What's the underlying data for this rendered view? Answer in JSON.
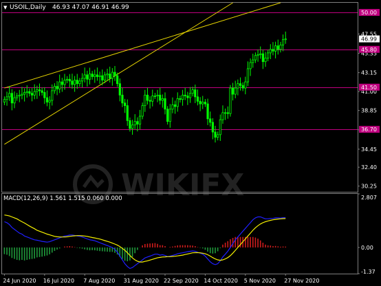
{
  "header": {
    "symbol_label": "USOIL,Daily",
    "ohlc_label": "46.93 47.07 46.91 46.99"
  },
  "macd_header": {
    "label": "MACD(12,26,9) 1.561 1.515 0.060 0.000"
  },
  "watermark": "WIKIFX",
  "colors": {
    "background": "#000000",
    "frame": "#7f7f7f",
    "candle": "#00ff00",
    "level_line": "#c0007f",
    "trend_line": "#e8d600",
    "macd_hist_positive": "#d01c1c",
    "macd_hist_negative": "#1f9a3b",
    "macd_line": "#2020ff",
    "signal_line": "#f5f000",
    "price_tag_bg": "#ffffff"
  },
  "chart_data": {
    "type": "candlestick",
    "title": "USOIL,Daily",
    "price_axis": {
      "ticks": [
        47.55,
        45.35,
        43.15,
        41.0,
        38.85,
        36.65,
        34.45,
        32.4,
        30.25
      ],
      "tick_labels": [
        "47.55",
        "45.35",
        "43.15",
        "41.00",
        "38.85",
        "36.65",
        "34.45",
        "32.40",
        "30.25"
      ],
      "range": [
        29.6,
        51.1
      ]
    },
    "date_axis": {
      "labels": [
        "24 Jun 2020",
        "16 Jul 2020",
        "7 Aug 2020",
        "31 Aug 2020",
        "22 Sep 2020",
        "14 Oct 2020",
        "5 Nov 2020",
        "27 Nov 2020"
      ]
    },
    "current_price": "46.99",
    "horizontal_levels": [
      {
        "value": 50.0,
        "label": "50.00"
      },
      {
        "value": 45.8,
        "label": "45.80"
      },
      {
        "value": 41.5,
        "label": "41.50"
      },
      {
        "value": 36.7,
        "label": "36.70"
      }
    ],
    "trend_lines": [
      {
        "from": {
          "bar": 0,
          "price": 41.4
        },
        "to": {
          "bar": 110,
          "price": 51.1
        }
      },
      {
        "from": {
          "bar": 0,
          "price": 35.0
        },
        "to": {
          "bar": 91,
          "price": 51.1
        }
      }
    ],
    "close": [
      40.1,
      40.4,
      40.8,
      39.7,
      40.3,
      40.5,
      40.6,
      40.7,
      40.9,
      41.0,
      40.8,
      40.6,
      41.0,
      41.2,
      41.1,
      40.9,
      40.3,
      39.8,
      40.0,
      41.1,
      41.6,
      41.3,
      42.1,
      41.8,
      42.3,
      42.4,
      42.2,
      41.8,
      42.3,
      41.9,
      42.2,
      42.5,
      42.9,
      42.4,
      43.0,
      42.7,
      42.9,
      42.7,
      42.8,
      42.3,
      42.9,
      43.0,
      42.5,
      43.2,
      42.8,
      41.9,
      40.6,
      39.7,
      39.4,
      37.7,
      36.8,
      37.2,
      37.6,
      37.3,
      38.2,
      39.4,
      40.6,
      40.0,
      39.9,
      40.5,
      40.5,
      40.6,
      40.0,
      40.2,
      39.0,
      37.6,
      39.0,
      39.5,
      39.3,
      40.2,
      40.1,
      40.6,
      40.5,
      40.3,
      40.8,
      41.2,
      40.4,
      39.9,
      39.6,
      39.8,
      39.6,
      37.9,
      37.5,
      36.4,
      35.8,
      36.1,
      37.8,
      38.6,
      38.6,
      38.5,
      41.4,
      40.7,
      41.4,
      41.9,
      41.7,
      41.4,
      42.1,
      43.6,
      44.3,
      44.6,
      45.1,
      45.2,
      45.3,
      44.4,
      44.8,
      45.4,
      45.8,
      45.6,
      46.2,
      45.8,
      46.3,
      46.9,
      46.99
    ],
    "macd": {
      "axis_ticks": [
        2.807,
        0.0,
        -1.37
      ],
      "axis_tick_labels": [
        "2.807",
        "0.00",
        "-1.37"
      ],
      "range": [
        -1.37,
        2.807
      ],
      "macd_line": [
        1.35,
        1.3,
        1.2,
        1.05,
        0.95,
        0.85,
        0.75,
        0.7,
        0.6,
        0.55,
        0.5,
        0.45,
        0.4,
        0.38,
        0.35,
        0.32,
        0.3,
        0.28,
        0.3,
        0.35,
        0.4,
        0.45,
        0.5,
        0.55,
        0.6,
        0.62,
        0.65,
        0.65,
        0.63,
        0.6,
        0.58,
        0.55,
        0.5,
        0.45,
        0.4,
        0.38,
        0.35,
        0.3,
        0.25,
        0.2,
        0.15,
        0.1,
        0.05,
        0.0,
        -0.1,
        -0.25,
        -0.45,
        -0.65,
        -0.85,
        -1.0,
        -1.1,
        -1.05,
        -0.95,
        -0.85,
        -0.75,
        -0.65,
        -0.55,
        -0.5,
        -0.45,
        -0.4,
        -0.35,
        -0.35,
        -0.4,
        -0.38,
        -0.42,
        -0.48,
        -0.45,
        -0.42,
        -0.38,
        -0.33,
        -0.3,
        -0.28,
        -0.25,
        -0.22,
        -0.2,
        -0.18,
        -0.2,
        -0.25,
        -0.3,
        -0.35,
        -0.45,
        -0.6,
        -0.75,
        -0.85,
        -0.9,
        -0.85,
        -0.7,
        -0.5,
        -0.35,
        -0.2,
        0.0,
        0.2,
        0.4,
        0.55,
        0.7,
        0.85,
        1.0,
        1.15,
        1.3,
        1.45,
        1.55,
        1.6,
        1.6,
        1.55,
        1.5,
        1.5,
        1.52,
        1.52,
        1.55,
        1.55,
        1.54,
        1.56,
        1.561
      ],
      "signal_line": [
        1.7,
        1.68,
        1.65,
        1.6,
        1.55,
        1.5,
        1.42,
        1.35,
        1.28,
        1.2,
        1.12,
        1.05,
        0.98,
        0.9,
        0.85,
        0.8,
        0.75,
        0.7,
        0.66,
        0.62,
        0.58,
        0.56,
        0.55,
        0.55,
        0.55,
        0.56,
        0.58,
        0.6,
        0.61,
        0.62,
        0.62,
        0.61,
        0.6,
        0.58,
        0.55,
        0.52,
        0.5,
        0.47,
        0.44,
        0.4,
        0.36,
        0.32,
        0.28,
        0.23,
        0.18,
        0.12,
        0.05,
        -0.05,
        -0.15,
        -0.28,
        -0.42,
        -0.55,
        -0.65,
        -0.72,
        -0.76,
        -0.76,
        -0.73,
        -0.7,
        -0.66,
        -0.62,
        -0.58,
        -0.54,
        -0.52,
        -0.5,
        -0.49,
        -0.48,
        -0.48,
        -0.47,
        -0.46,
        -0.44,
        -0.42,
        -0.4,
        -0.37,
        -0.34,
        -0.31,
        -0.28,
        -0.27,
        -0.27,
        -0.28,
        -0.3,
        -0.33,
        -0.38,
        -0.45,
        -0.53,
        -0.6,
        -0.65,
        -0.67,
        -0.65,
        -0.6,
        -0.53,
        -0.43,
        -0.3,
        -0.15,
        0.0,
        0.15,
        0.3,
        0.45,
        0.6,
        0.75,
        0.9,
        1.03,
        1.14,
        1.23,
        1.3,
        1.35,
        1.39,
        1.42,
        1.45,
        1.47,
        1.49,
        1.5,
        1.51,
        1.515
      ]
    }
  }
}
